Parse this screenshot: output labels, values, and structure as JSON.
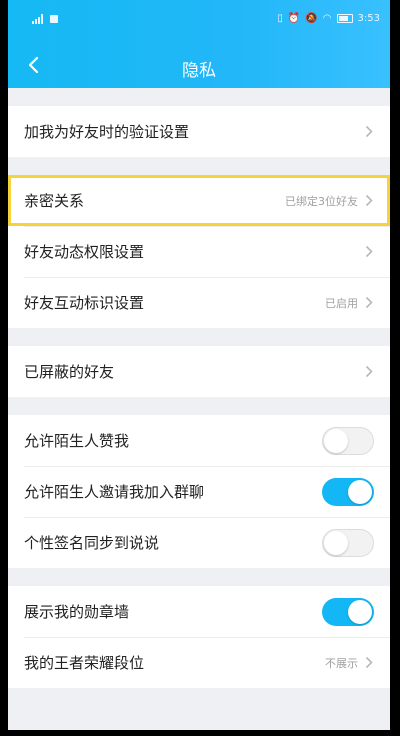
{
  "status_bar": {
    "time": "3:53"
  },
  "header": {
    "title": "隐私"
  },
  "colors": {
    "accent": "#13b7f5",
    "highlight": "#f5d33c"
  },
  "settings": {
    "verification": {
      "label": "加我为好友时的验证设置"
    },
    "intimate": {
      "label": "亲密关系",
      "value": "已绑定3位好友"
    },
    "feed_permission": {
      "label": "好友动态权限设置"
    },
    "interaction_mark": {
      "label": "好友互动标识设置",
      "value": "已启用"
    },
    "blocked": {
      "label": "已屏蔽的好友"
    },
    "stranger_like": {
      "label": "允许陌生人赞我",
      "enabled": false
    },
    "stranger_invite": {
      "label": "允许陌生人邀请我加入群聊",
      "enabled": true
    },
    "signature_sync": {
      "label": "个性签名同步到说说",
      "enabled": false
    },
    "badge_wall": {
      "label": "展示我的勋章墙",
      "enabled": true
    },
    "honor_rank": {
      "label": "我的王者荣耀段位",
      "value": "不展示"
    }
  }
}
